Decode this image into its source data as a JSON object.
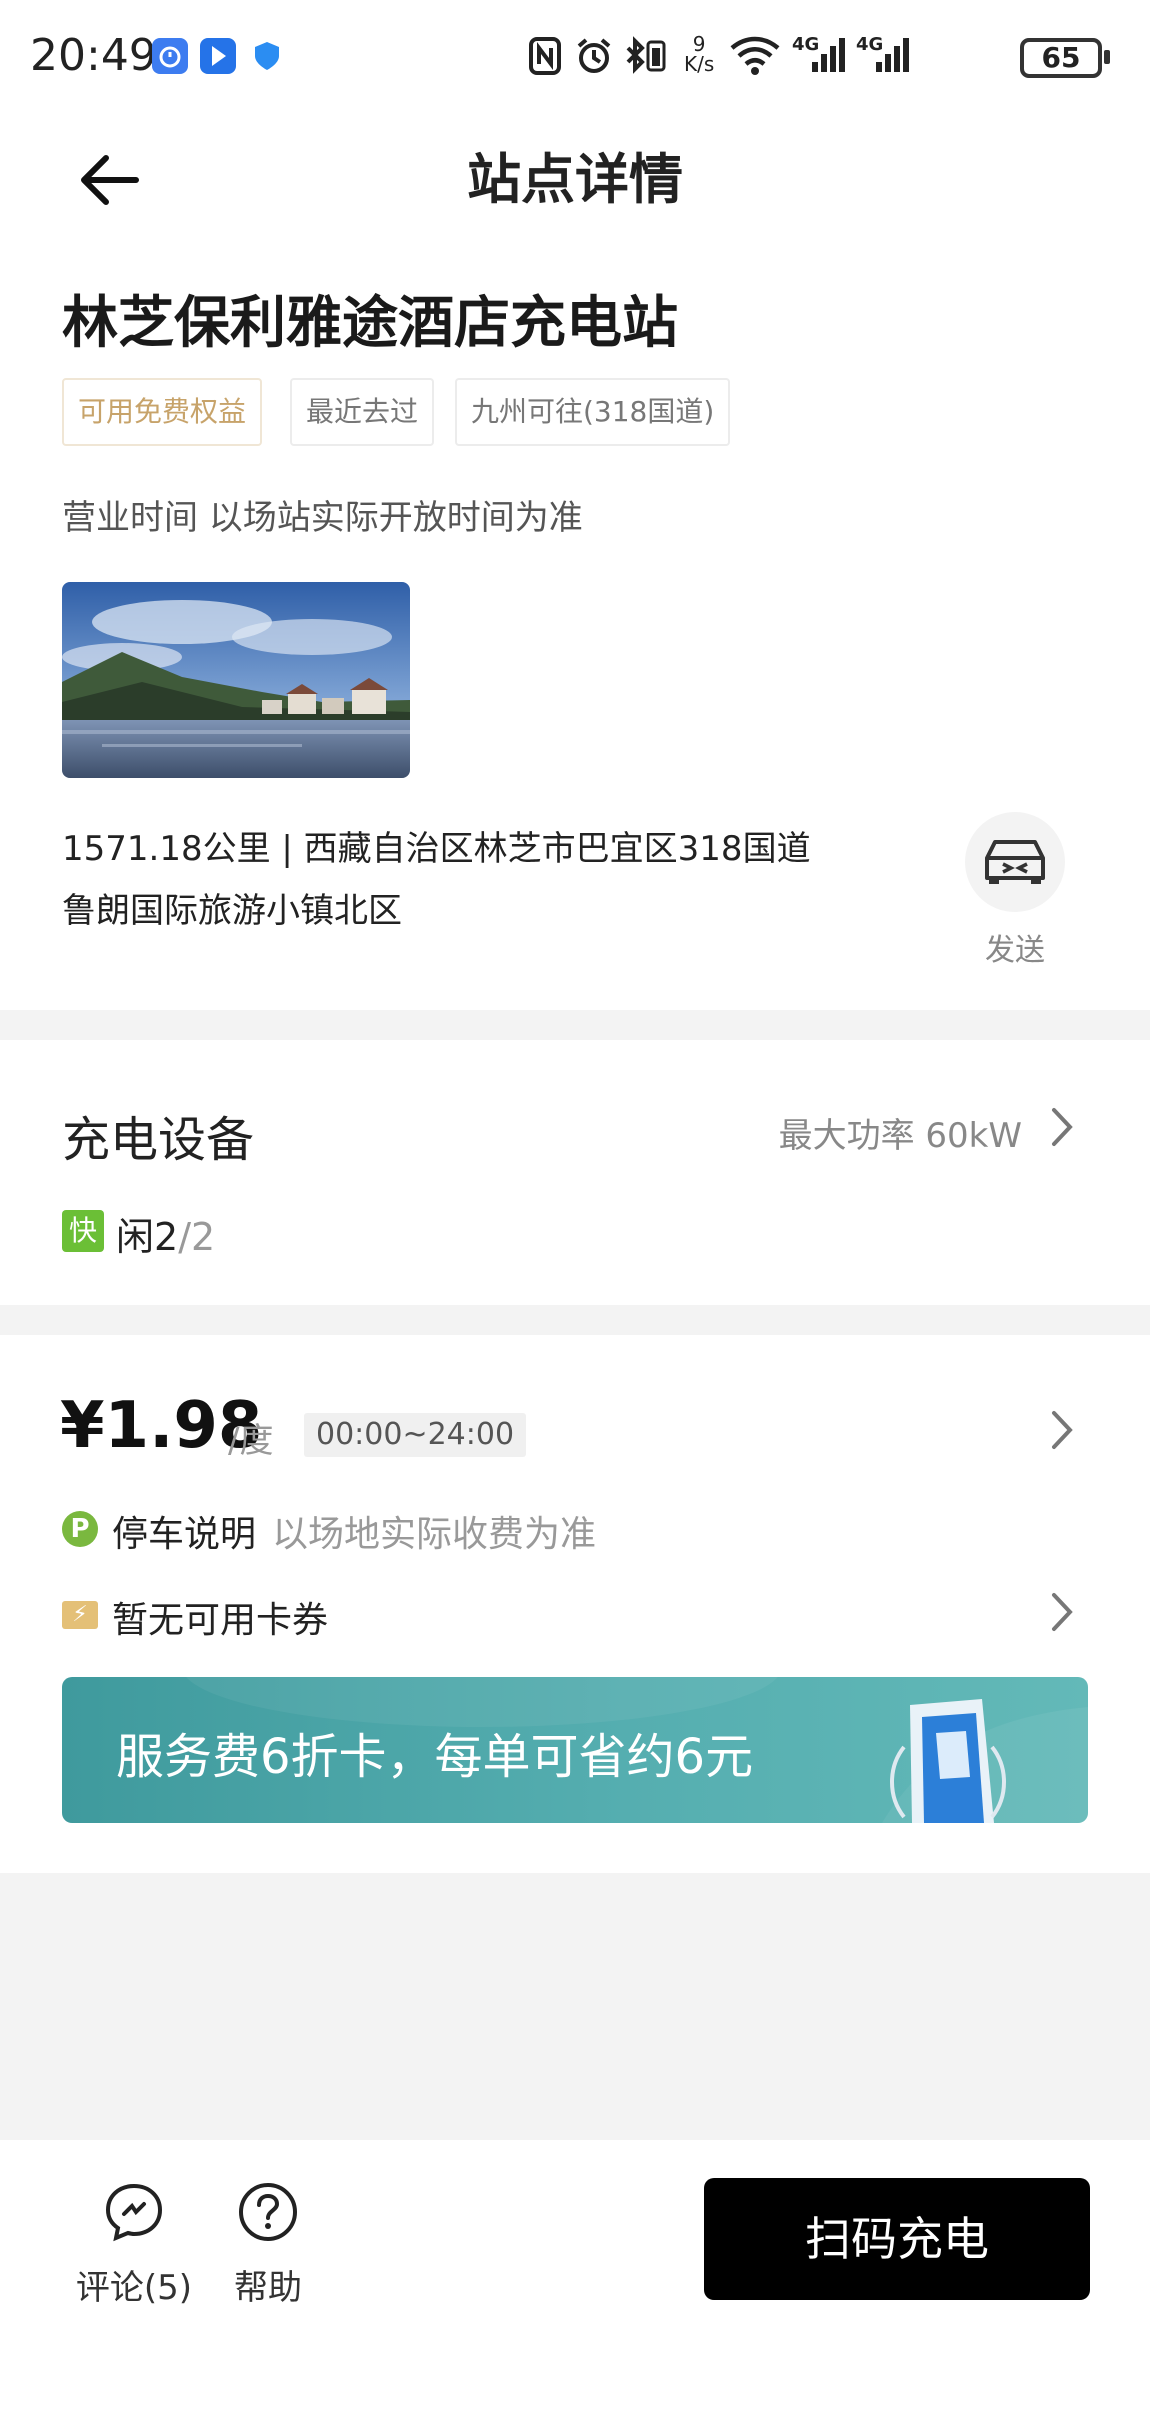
{
  "status_bar": {
    "time": "20:49",
    "network_speed_value": "9",
    "network_speed_unit": "K/s",
    "battery": "65",
    "signal_1": "4G",
    "signal_2": "4G"
  },
  "header": {
    "title": "站点详情",
    "back_icon": "arrow-left-icon"
  },
  "station": {
    "name": "林芝保利雅途酒店充电站",
    "tags": [
      "可用免费权益",
      "最近去过",
      "九州可往(318国道)"
    ],
    "hours": "营业时间 以场站实际开放时间为准",
    "address_line1": "1571.18公里 | 西藏自治区林芝市巴宜区318国道",
    "address_line2": "鲁朗国际旅游小镇北区",
    "send_label": "发送"
  },
  "equipment": {
    "title": "充电设备",
    "max_power": "最大功率 60kW",
    "fast_badge": "快",
    "idle_label": "闲2",
    "total": "/2"
  },
  "pricing": {
    "price": "¥1.98",
    "unit": "/度",
    "time_range": "00:00~24:00",
    "parking_icon": "P",
    "parking_label": "停车说明",
    "parking_note": "以场地实际收费为准",
    "coupon_label": "暂无可用卡券",
    "promo_text": "服务费6折卡，每单可省约6元"
  },
  "bottom_bar": {
    "comment_label": "评论(5)",
    "help_label": "帮助",
    "scan_button": "扫码充电"
  },
  "colors": {
    "gold_tag": "#c7a36a",
    "fast_green": "#6bbf36",
    "promo_teal": "#4aa5a7",
    "primary_button": "#000000"
  }
}
